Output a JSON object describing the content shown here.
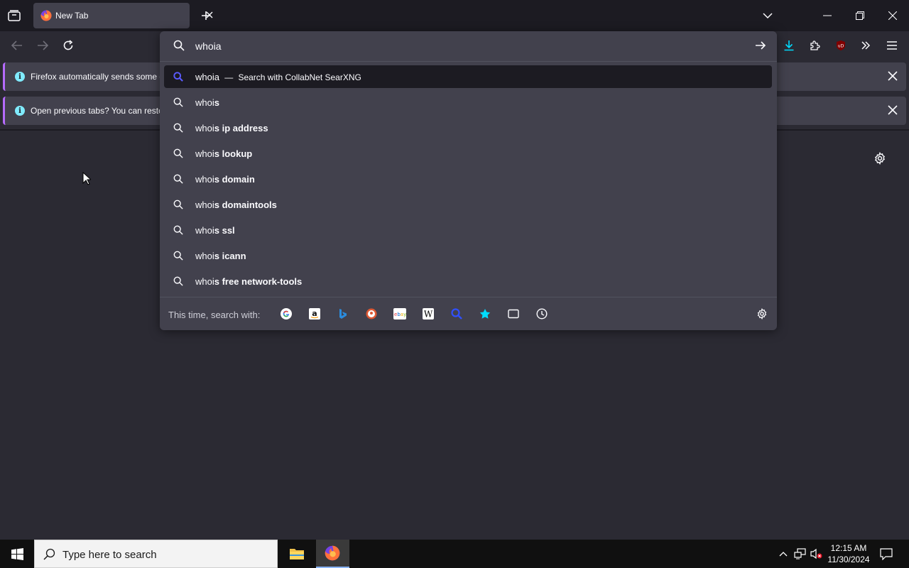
{
  "tab": {
    "title": "New Tab"
  },
  "notifications": [
    {
      "text": "Firefox automatically sends some d"
    },
    {
      "text": "Open previous tabs? You can restor"
    }
  ],
  "urlbar": {
    "query": "whoia",
    "heuristic": {
      "query": "whoia",
      "dash": "—",
      "action": "Search with CollabNet SearXNG"
    },
    "suggestions": [
      {
        "typed": "whoi",
        "rest": "s"
      },
      {
        "typed": "whoi",
        "rest": "s ip address"
      },
      {
        "typed": "whoi",
        "rest": "s lookup"
      },
      {
        "typed": "whoi",
        "rest": "s domain"
      },
      {
        "typed": "whoi",
        "rest": "s domaintools"
      },
      {
        "typed": "whoi",
        "rest": "s ssl"
      },
      {
        "typed": "whoi",
        "rest": "s icann"
      },
      {
        "typed": "whoi",
        "rest": "s free network-tools"
      }
    ],
    "oneoff_label": "This time, search with:",
    "engines": [
      "google-icon",
      "amazon-icon",
      "bing-icon",
      "duckduckgo-icon",
      "ebay-icon",
      "wikipedia-icon",
      "searxng-icon",
      "bookmarks-icon",
      "tabs-icon",
      "history-icon"
    ]
  },
  "taskbar": {
    "search_placeholder": "Type here to search",
    "time": "12:15 AM",
    "date": "11/30/2024"
  },
  "colors": {
    "accent": "#b66bff",
    "info": "#80ebff",
    "selected_search": "#5b5bff",
    "download": "#0df"
  }
}
